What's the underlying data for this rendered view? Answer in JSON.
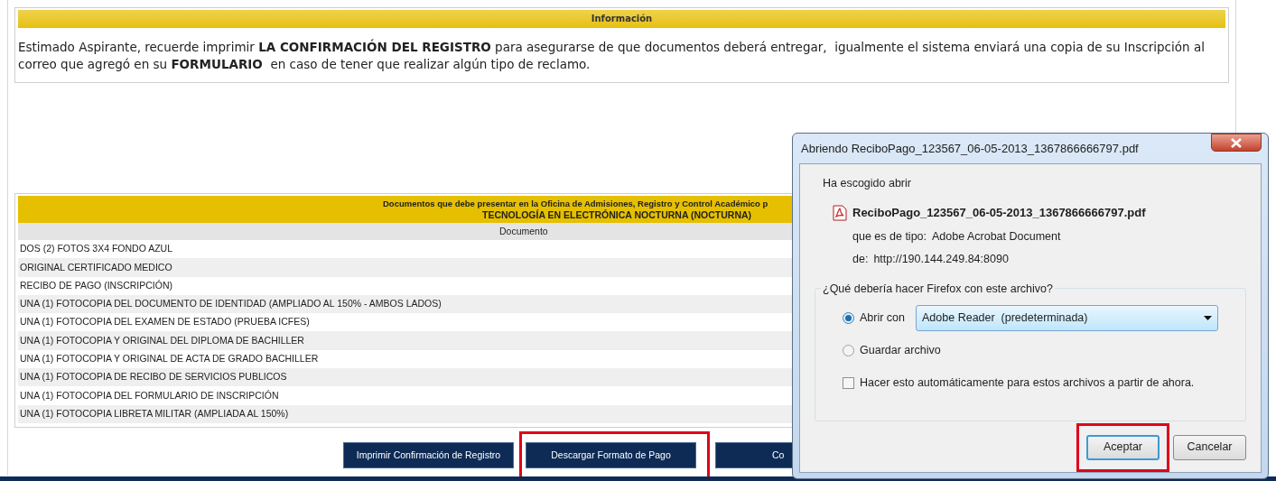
{
  "info_panel": {
    "title": "Información",
    "message": "Estimado Aspirante, recuerde imprimir **LA CONFIRMACIÓN DEL REGISTRO** para asegurarse de que documentos deberá entregar,  igualmente el sistema enviará una copia de su Inscripción al correo que agregó en su **FORMULARIO**  en caso de tener que realizar algún tipo de reclamo."
  },
  "documents_panel": {
    "title": "Documentos que debe presentar en la Oficina de Admisiones, Registro y Control Académico p",
    "program": "TECNOLOGÍA EN ELECTRÓNICA NOCTURNA (NOCTURNA)",
    "column": "Documento",
    "rows": [
      "DOS (2) FOTOS 3X4 FONDO AZUL",
      "ORIGINAL CERTIFICADO MEDICO",
      "RECIBO DE PAGO (INSCRIPCIÓN)",
      "UNA (1) FOTOCOPIA DEL DOCUMENTO DE IDENTIDAD (AMPLIADO AL 150% - AMBOS LADOS)",
      "UNA (1) FOTOCOPIA DEL EXAMEN DE ESTADO (PRUEBA ICFES)",
      "UNA (1) FOTOCOPIA Y ORIGINAL DEL DIPLOMA DE BACHILLER",
      "UNA (1) FOTOCOPIA Y ORIGINAL DE ACTA DE GRADO BACHILLER",
      "UNA (1) FOTOCOPIA DE RECIBO DE SERVICIOS PUBLICOS",
      "UNA (1) FOTOCOPIA DEL FORMULARIO DE INSCRIPCIÓN",
      "UNA (1) FOTOCOPIA LIBRETA MILITAR (AMPLIADA AL 150%)"
    ]
  },
  "buttons": [
    {
      "label": "Imprimir Confirmación de Registro",
      "highlighted": false
    },
    {
      "label": "Descargar Formato de Pago",
      "highlighted": true
    },
    {
      "label": "Co",
      "highlighted": false
    }
  ],
  "dialog": {
    "title": "Abriendo ReciboPago_123567_06-05-2013_1367866666797.pdf",
    "intro": "Ha escogido abrir",
    "file_name": "ReciboPago_123567_06-05-2013_1367866666797.pdf",
    "type_label": "que es de tipo:",
    "type_value": "Adobe Acrobat Document",
    "from_label": "de:",
    "from_value": "http://190.144.249.84:8090",
    "question": "¿Qué debería hacer Firefox con este archivo?",
    "options": [
      {
        "label": "Abrir con",
        "selected": true
      },
      {
        "label": "Guardar archivo",
        "selected": false
      }
    ],
    "application": "Adobe Reader  (predeterminada)",
    "auto": {
      "label": "Hacer esto automáticamente para estos archivos a partir de ahora.",
      "checked": false
    },
    "buttons": [
      {
        "label": "Aceptar",
        "highlighted": true
      },
      {
        "label": "Cancelar",
        "highlighted": false
      }
    ]
  }
}
